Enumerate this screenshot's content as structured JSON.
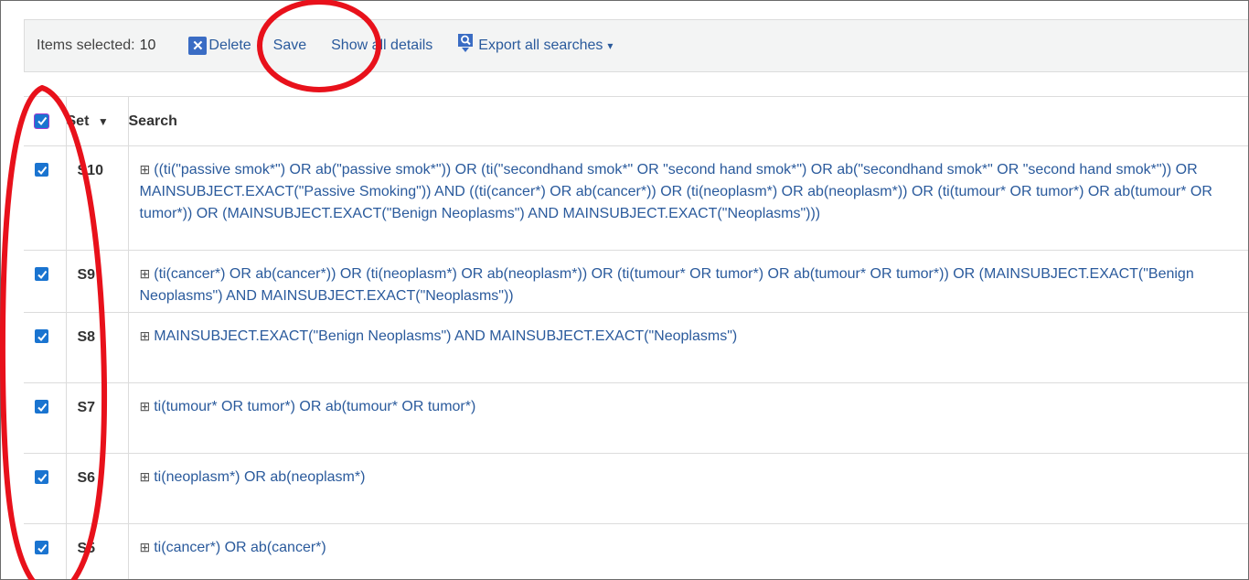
{
  "toolbar": {
    "items_selected_label": "Items selected:",
    "items_selected_count": "10",
    "delete_label": "Delete",
    "save_label": "Save",
    "show_details_label": "Show all details",
    "export_label": "Export all searches",
    "export_caret": "▾"
  },
  "table": {
    "headers": {
      "set": "Set",
      "set_sort_icon": "▼",
      "search": "Search"
    },
    "rows": [
      {
        "set": "S10",
        "checked": true,
        "query": "((ti(\"passive smok*\") OR ab(\"passive smok*\")) OR (ti(\"secondhand smok*\" OR \"second hand smok*\") OR ab(\"secondhand smok*\" OR \"second hand smok*\")) OR MAINSUBJECT.EXACT(\"Passive Smoking\")) AND ((ti(cancer*) OR ab(cancer*)) OR (ti(neoplasm*) OR ab(neoplasm*)) OR (ti(tumour* OR tumor*) OR ab(tumour* OR tumor*)) OR (MAINSUBJECT.EXACT(\"Benign Neoplasms\") AND MAINSUBJECT.EXACT(\"Neoplasms\")))"
      },
      {
        "set": "S9",
        "checked": true,
        "query": "(ti(cancer*) OR ab(cancer*)) OR (ti(neoplasm*) OR ab(neoplasm*)) OR (ti(tumour* OR tumor*) OR ab(tumour* OR tumor*)) OR (MAINSUBJECT.EXACT(\"Benign Neoplasms\") AND MAINSUBJECT.EXACT(\"Neoplasms\"))"
      },
      {
        "set": "S8",
        "checked": true,
        "query": "MAINSUBJECT.EXACT(\"Benign Neoplasms\") AND MAINSUBJECT.EXACT(\"Neoplasms\")"
      },
      {
        "set": "S7",
        "checked": true,
        "query": "ti(tumour* OR tumor*) OR ab(tumour* OR tumor*)"
      },
      {
        "set": "S6",
        "checked": true,
        "query": "ti(neoplasm*) OR ab(neoplasm*)"
      },
      {
        "set": "S5",
        "checked": true,
        "query": "ti(cancer*) OR ab(cancer*)"
      }
    ],
    "expander_glyph": "⊞"
  },
  "colors": {
    "link": "#2a5a9c",
    "checkbox": "#1a74d0",
    "annotation": "#e8111b",
    "toolbar_bg": "#f3f4f4"
  },
  "icons": [
    "delete-x-icon",
    "export-icon",
    "checkmark-icon",
    "expand-plus-icon",
    "sort-caret-icon"
  ]
}
